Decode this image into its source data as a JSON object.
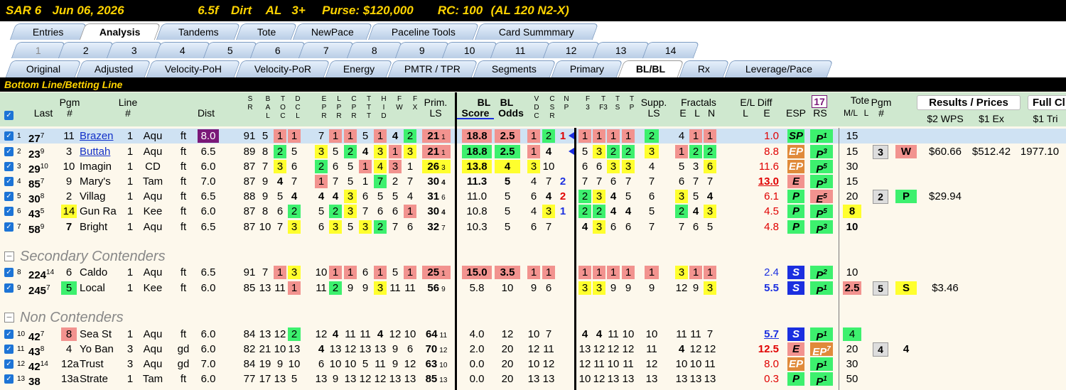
{
  "title": {
    "race": "SAR",
    "num": "6",
    "date": "Jun 06, 2026",
    "dist": "6.5f",
    "surface": "Dirt",
    "cls": "AL",
    "age": "3+",
    "purse": "Purse: $120,000",
    "rc": "RC: 100",
    "cond": "(AL 120 N2-X)"
  },
  "tabs1": [
    "Entries",
    "Analysis",
    "Tandems",
    "Tote",
    "NewPace",
    "Paceline Tools",
    "Card Summmary"
  ],
  "tabs2": [
    "1",
    "2",
    "3",
    "4",
    "5",
    "6",
    "7",
    "8",
    "9",
    "10",
    "11",
    "12",
    "13",
    "14"
  ],
  "tabs3": [
    "Original",
    "Adjusted",
    "Velocity-PoH",
    "Velocity-PoR",
    "Energy",
    "PMTR / TPR",
    "Segments",
    "Primary",
    "BL/BL",
    "Rx",
    "Leverage/Pace"
  ],
  "banner": "Bottom Line/Betting Line",
  "headers": {
    "last": "Last",
    "pgm": "Pgm",
    "pgm2": "#",
    "line": "Line",
    "line2": "#",
    "dist": "Dist",
    "prim": "Prim.",
    "ls": "LS",
    "bl1": "BL",
    "bl2": "BL",
    "score": "Score",
    "odds": "Odds",
    "supp": "Supp.",
    "supp2": "LS",
    "fract": "Fractals",
    "fe": "E",
    "fl": "L",
    "fn": "N",
    "eldiff": "E/L Diff",
    "ell": "L",
    "ele": "E",
    "esp": "ESP",
    "rsnum": "17",
    "rs": "RS",
    "tote": "Tote",
    "ml": "M/L",
    "ml2": "L",
    "pgm3": "Pgm",
    "pgm4": "#",
    "res": "Results / Prices",
    "wps": "$2 WPS",
    "ex": "$1 Ex",
    "full": "Full Cl",
    "tri": "$1 Tri",
    "v1": [
      "S",
      "R"
    ],
    "v2": [
      "B",
      "A",
      "L"
    ],
    "v3": [
      "T",
      "O",
      "C"
    ],
    "v4": [
      "D",
      "C",
      "L"
    ],
    "v5": [
      "E",
      "P",
      "R"
    ],
    "v6": [
      "L",
      "P",
      "R"
    ],
    "v7": [
      "C",
      "P",
      "R"
    ],
    "v8": [
      "T",
      "T",
      "T"
    ],
    "v9": [
      "H",
      "I",
      "D"
    ],
    "v10": [
      "F",
      "W"
    ],
    "v11": [
      "F",
      "X"
    ],
    "v12": [
      "V",
      "D",
      "C"
    ],
    "v13": [
      "C",
      "S",
      "R"
    ],
    "v14": [
      "N",
      "P"
    ],
    "v15": [
      "F",
      "3"
    ],
    "v16": [
      "T",
      "F3"
    ],
    "v17": [
      "T",
      "S"
    ],
    "v18": [
      "T",
      "P"
    ],
    "v19": [
      "T",
      "P"
    ]
  },
  "sections": {
    "secondary": "Secondary Contenders",
    "non": "Non Contenders"
  },
  "rows": [
    {
      "i": "1",
      "last": "27",
      "ls": "7",
      "pgm": "11",
      "name": "Brazen",
      "line": "1",
      "trk": "Aqu",
      "sf": "ft",
      "dist": "8.0",
      "sr": "91",
      "bal": "5",
      "toc": "1",
      "dcl": "1",
      "epr": "7",
      "lpr": "1",
      "cpr": "1",
      "t": "5",
      "hid": "1",
      "fw": "4",
      "fx": "2",
      "prim": "21",
      "prim2": "1",
      "score": "18.8",
      "odds": "2.5",
      "vdc": "1",
      "csr": "2",
      "np": "1",
      "f3": "1",
      "tf3": "1",
      "ts": "1",
      "tp": "1",
      "supp": "2",
      "fe": "4",
      "fl": "1",
      "fn": "1",
      "eld": "1.0",
      "esp": "SP",
      "rs": "P",
      "rs2": "1",
      "ml": "15"
    },
    {
      "i": "2",
      "last": "23",
      "ls": "9",
      "pgm": "3",
      "name": "Buttah",
      "line": "1",
      "trk": "Aqu",
      "sf": "ft",
      "dist": "6.5",
      "sr": "89",
      "bal": "8",
      "toc": "2",
      "dcl": "5",
      "epr": "3",
      "lpr": "5",
      "cpr": "2",
      "t": "4",
      "hid": "3",
      "fw": "1",
      "fx": "3",
      "prim": "21",
      "prim2": "1",
      "score": "18.8",
      "odds": "2.5",
      "vdc": "1",
      "csr": "4",
      "np": "",
      "f3": "5",
      "tf3": "3",
      "ts": "2",
      "tp": "2",
      "supp": "3",
      "fe": "1",
      "fl": "2",
      "fn": "2",
      "eld": "8.8",
      "esp": "EP",
      "rs": "P",
      "rs2": "3",
      "ml": "15",
      "rp": "3",
      "rl": "W",
      "wps": "$60.66",
      "ex": "$512.42",
      "tri": "1977.10"
    },
    {
      "i": "3",
      "last": "29",
      "ls": "10",
      "pgm": "10",
      "name": "Imagin",
      "line": "1",
      "trk": "CD",
      "sf": "ft",
      "dist": "6.0",
      "sr": "87",
      "bal": "7",
      "toc": "3",
      "dcl": "6",
      "epr": "2",
      "lpr": "6",
      "cpr": "5",
      "t": "1",
      "hid": "4",
      "fw": "3",
      "fx": "1",
      "prim": "26",
      "prim2": "3",
      "score": "13.8",
      "odds": "4",
      "vdc": "3",
      "csr": "10",
      "np": "",
      "f3": "6",
      "tf3": "6",
      "ts": "3",
      "tp": "3",
      "supp": "4",
      "fe": "5",
      "fl": "3",
      "fn": "6",
      "eld": "11.6",
      "esp": "EP",
      "rs": "P",
      "rs2": "5",
      "ml": "30"
    },
    {
      "i": "4",
      "last": "85",
      "ls": "7",
      "pgm": "9",
      "name": "Mary's",
      "line": "1",
      "trk": "Tam",
      "sf": "ft",
      "dist": "7.0",
      "sr": "87",
      "bal": "9",
      "toc": "4",
      "dcl": "7",
      "epr": "1",
      "lpr": "7",
      "cpr": "5",
      "t": "1",
      "hid": "7",
      "fw": "2",
      "fx": "7",
      "prim": "30",
      "prim2": "4",
      "score": "11.3",
      "odds": "5",
      "vdc": "4",
      "csr": "7",
      "np": "2",
      "f3": "7",
      "tf3": "7",
      "ts": "6",
      "tp": "7",
      "supp": "7",
      "fe": "6",
      "fl": "7",
      "fn": "7",
      "eld": "13.0",
      "esp": "E",
      "rs": "P",
      "rs2": "3",
      "ml": "15"
    },
    {
      "i": "5",
      "last": "30",
      "ls": "8",
      "pgm": "2",
      "name": "Villag",
      "line": "1",
      "trk": "Aqu",
      "sf": "ft",
      "dist": "6.5",
      "sr": "88",
      "bal": "9",
      "toc": "5",
      "dcl": "4",
      "epr": "4",
      "lpr": "4",
      "cpr": "3",
      "t": "6",
      "hid": "5",
      "fw": "5",
      "fx": "4",
      "prim": "31",
      "prim2": "6",
      "score": "11.0",
      "odds": "5",
      "vdc": "6",
      "csr": "4",
      "np": "2",
      "f3": "2",
      "tf3": "3",
      "ts": "4",
      "tp": "5",
      "supp": "6",
      "fe": "3",
      "fl": "5",
      "fn": "4",
      "eld": "6.1",
      "esp": "P",
      "rs": "E",
      "rs2": "5",
      "ml": "20",
      "rp": "2",
      "rl": "P",
      "wps": "$29.94"
    },
    {
      "i": "6",
      "last": "43",
      "ls": "5",
      "pgm": "14",
      "name": "Gun Ra",
      "line": "1",
      "trk": "Kee",
      "sf": "ft",
      "dist": "6.0",
      "sr": "87",
      "bal": "8",
      "toc": "6",
      "dcl": "2",
      "epr": "5",
      "lpr": "2",
      "cpr": "3",
      "t": "7",
      "hid": "6",
      "fw": "6",
      "fx": "1",
      "prim": "30",
      "prim2": "4",
      "score": "10.8",
      "odds": "5",
      "vdc": "4",
      "csr": "3",
      "np": "1",
      "f3": "2",
      "tf3": "2",
      "ts": "4",
      "tp": "4",
      "supp": "5",
      "fe": "2",
      "fl": "4",
      "fn": "3",
      "eld": "4.5",
      "esp": "P",
      "rs": "P",
      "rs2": "5",
      "ml": "8"
    },
    {
      "i": "7",
      "last": "58",
      "ls": "9",
      "pgm": "7",
      "name": "Bright",
      "line": "1",
      "trk": "Aqu",
      "sf": "ft",
      "dist": "6.5",
      "sr": "87",
      "bal": "10",
      "toc": "7",
      "dcl": "3",
      "epr": "6",
      "lpr": "3",
      "cpr": "5",
      "t": "3",
      "hid": "2",
      "fw": "7",
      "fx": "6",
      "prim": "32",
      "prim2": "7",
      "score": "10.3",
      "odds": "5",
      "vdc": "6",
      "csr": "7",
      "np": "",
      "f3": "4",
      "tf3": "3",
      "ts": "6",
      "tp": "6",
      "supp": "7",
      "fe": "7",
      "fl": "6",
      "fn": "5",
      "eld": "4.8",
      "esp": "P",
      "rs": "P",
      "rs2": "3",
      "ml": "10"
    },
    {
      "i": "8",
      "last": "224",
      "ls": "14",
      "pgm": "6",
      "name": "Caldo",
      "line": "1",
      "trk": "Aqu",
      "sf": "ft",
      "dist": "6.5",
      "sr": "91",
      "bal": "7",
      "toc": "1",
      "dcl": "3",
      "epr": "10",
      "lpr": "1",
      "cpr": "1",
      "t": "6",
      "hid": "1",
      "fw": "5",
      "fx": "1",
      "prim": "25",
      "prim2": "1",
      "score": "15.0",
      "odds": "3.5",
      "vdc": "1",
      "csr": "1",
      "np": "",
      "f3": "1",
      "tf3": "1",
      "ts": "1",
      "tp": "1",
      "supp": "1",
      "fe": "3",
      "fl": "1",
      "fn": "1",
      "eld": "2.4",
      "esp": "S",
      "rs": "P",
      "rs2": "2",
      "ml": "10"
    },
    {
      "i": "9",
      "last": "245",
      "ls": "7",
      "pgm": "5",
      "name": "Local",
      "line": "1",
      "trk": "Kee",
      "sf": "ft",
      "dist": "6.0",
      "sr": "85",
      "bal": "13",
      "toc": "11",
      "dcl": "1",
      "epr": "11",
      "lpr": "2",
      "cpr": "9",
      "t": "9",
      "hid": "3",
      "fw": "11",
      "fx": "11",
      "prim": "56",
      "prim2": "9",
      "score": "5.8",
      "odds": "10",
      "vdc": "9",
      "csr": "6",
      "np": "",
      "f3": "3",
      "tf3": "3",
      "ts": "9",
      "tp": "9",
      "supp": "9",
      "fe": "12",
      "fl": "9",
      "fn": "3",
      "eld": "5.5",
      "esp": "S",
      "rs": "P",
      "rs2": "1",
      "ml": "2.5",
      "rp": "5",
      "rl": "S",
      "wps": "$3.46"
    },
    {
      "i": "10",
      "last": "42",
      "ls": "7",
      "pgm": "8",
      "name": "Sea St",
      "line": "1",
      "trk": "Aqu",
      "sf": "ft",
      "dist": "6.0",
      "sr": "84",
      "bal": "13",
      "toc": "12",
      "dcl": "2",
      "epr": "12",
      "lpr": "4",
      "cpr": "11",
      "t": "11",
      "hid": "4",
      "fw": "12",
      "fx": "10",
      "prim": "64",
      "prim2": "11",
      "score": "4.0",
      "odds": "12",
      "vdc": "10",
      "csr": "7",
      "np": "",
      "f3": "4",
      "tf3": "4",
      "ts": "11",
      "tp": "10",
      "supp": "10",
      "fe": "11",
      "fl": "11",
      "fn": "7",
      "eld": "5.7",
      "esp": "S",
      "rs": "P",
      "rs2": "1",
      "ml": "4"
    },
    {
      "i": "11",
      "last": "43",
      "ls": "8",
      "pgm": "4",
      "name": "Yo Ban",
      "line": "3",
      "trk": "Aqu",
      "sf": "gd",
      "dist": "6.0",
      "sr": "82",
      "bal": "21",
      "toc": "10",
      "dcl": "13",
      "epr": "4",
      "lpr": "13",
      "cpr": "12",
      "t": "13",
      "hid": "13",
      "fw": "9",
      "fx": "6",
      "prim": "70",
      "prim2": "12",
      "score": "2.0",
      "odds": "20",
      "vdc": "12",
      "csr": "11",
      "np": "",
      "f3": "13",
      "tf3": "12",
      "ts": "12",
      "tp": "12",
      "supp": "11",
      "fe": "4",
      "fl": "12",
      "fn": "12",
      "eld": "12.5",
      "esp": "E",
      "rs": "EP",
      "rs2": "7",
      "ml": "20",
      "rp": "4",
      "rl": "4"
    },
    {
      "i": "12",
      "last": "42",
      "ls": "14",
      "pgm": "12a",
      "name": "Trust",
      "line": "3",
      "trk": "Aqu",
      "sf": "gd",
      "dist": "7.0",
      "sr": "84",
      "bal": "19",
      "toc": "9",
      "dcl": "10",
      "epr": "6",
      "lpr": "10",
      "cpr": "10",
      "t": "5",
      "hid": "11",
      "fw": "9",
      "fx": "12",
      "prim": "63",
      "prim2": "10",
      "score": "0.0",
      "odds": "20",
      "vdc": "10",
      "csr": "12",
      "np": "",
      "f3": "12",
      "tf3": "11",
      "ts": "10",
      "tp": "11",
      "supp": "12",
      "fe": "10",
      "fl": "10",
      "fn": "11",
      "eld": "8.0",
      "esp": "EP",
      "rs": "P",
      "rs2": "1",
      "ml": "30"
    },
    {
      "i": "13",
      "last": "38",
      "ls": "",
      "pgm": "13a",
      "name": "Strate",
      "line": "1",
      "trk": "Tam",
      "sf": "ft",
      "dist": "6.0",
      "sr": "77",
      "bal": "17",
      "toc": "13",
      "dcl": "5",
      "epr": "13",
      "lpr": "9",
      "cpr": "13",
      "t": "12",
      "hid": "12",
      "fw": "13",
      "fx": "13",
      "prim": "85",
      "prim2": "13",
      "score": "0.0",
      "odds": "20",
      "vdc": "13",
      "csr": "13",
      "np": "",
      "f3": "10",
      "tf3": "12",
      "ts": "13",
      "tp": "13",
      "supp": "13",
      "fe": "13",
      "fl": "13",
      "fn": "13",
      "eld": "0.3",
      "esp": "P",
      "rs": "P",
      "rs2": "1",
      "ml": "50"
    }
  ],
  "colors": {
    "title_bg": "#000000",
    "title_fg": "#ffd400",
    "red": "#f2938f",
    "green": "#3df06e",
    "yellow": "#ffff2e",
    "purple": "#7a1878",
    "blue": "#1b2fe0",
    "orange": "#e08a3a"
  }
}
